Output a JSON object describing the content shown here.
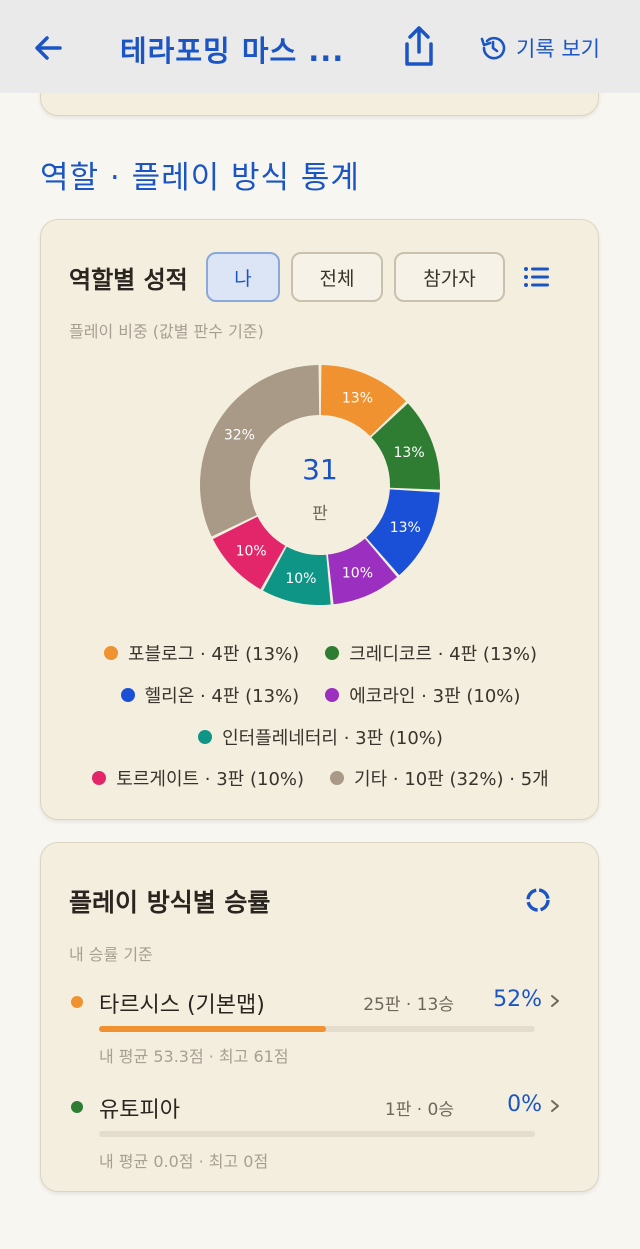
{
  "header": {
    "title": "테라포밍 마스 ...",
    "history_label": "기록 보기"
  },
  "section_title": "역할 · 플레이 방식 통계",
  "roles": {
    "title": "역할별 성적",
    "tabs": [
      "나",
      "전체",
      "참가자"
    ],
    "active_tab": "나",
    "caption": "플레이 비중 (값별 판수 기준)",
    "total": "31",
    "total_unit": "판",
    "slices": [
      {
        "name": "포블로그",
        "games": 4,
        "pct": 13,
        "label": "13%",
        "color": "#f0922f"
      },
      {
        "name": "크레디코르",
        "games": 4,
        "pct": 13,
        "label": "13%",
        "color": "#2e7d32"
      },
      {
        "name": "헬리온",
        "games": 4,
        "pct": 13,
        "label": "13%",
        "color": "#1a4fd8"
      },
      {
        "name": "에코라인",
        "games": 3,
        "pct": 10,
        "label": "10%",
        "color": "#9b2fc0"
      },
      {
        "name": "인터플레네터리",
        "games": 3,
        "pct": 10,
        "label": "10%",
        "color": "#0f9585"
      },
      {
        "name": "토르게이트",
        "games": 3,
        "pct": 10,
        "label": "10%",
        "color": "#e3266a"
      },
      {
        "name": "기타",
        "games": 10,
        "pct": 32,
        "label": "32%",
        "color": "#a89a86"
      }
    ],
    "legend": [
      [
        "포블로그 · 4판 (13%)",
        "크레디코르 · 4판 (13%)"
      ],
      [
        "헬리온 · 4판 (13%)",
        "에코라인 · 3판 (10%)"
      ],
      [
        "인터플레네터리 · 3판 (10%)"
      ],
      [
        "토르게이트 · 3판 (10%)",
        "기타 · 10판 (32%) · 5개"
      ]
    ],
    "legend_colors": [
      [
        "#f0922f",
        "#2e7d32"
      ],
      [
        "#1a4fd8",
        "#9b2fc0"
      ],
      [
        "#0f9585"
      ],
      [
        "#e3266a",
        "#a89a86"
      ]
    ]
  },
  "play": {
    "title": "플레이 방식별 승률",
    "caption": "내 승률 기준",
    "maps": [
      {
        "name": "타르시스 (기본맵)",
        "count": "25판 · 13승",
        "pct": "52%",
        "win_rate": 0.52,
        "meta": "내 평균 53.3점 · 최고 61점",
        "color": "#f0922f"
      },
      {
        "name": "유토피아",
        "count": "1판 · 0승",
        "pct": "0%",
        "win_rate": 0.0,
        "meta": "내 평균 0.0점 · 최고 0점",
        "color": "#2e7d32"
      }
    ]
  }
}
